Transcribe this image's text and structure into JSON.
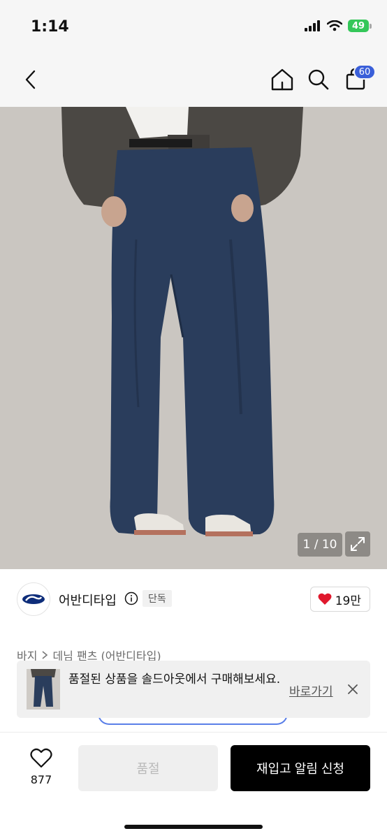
{
  "status_bar": {
    "time": "1:14",
    "battery": "49"
  },
  "header": {
    "cart_count": "60"
  },
  "gallery": {
    "counter": "1 / 10"
  },
  "brand": {
    "name": "어반디타입",
    "tag": "단독",
    "likes": "19만"
  },
  "breadcrumb": {
    "items": [
      "바지",
      "데님 팬츠 (어반디타입)"
    ]
  },
  "toast": {
    "message": "품절된 상품을 솔드아웃에서 구매해보세요.",
    "link": "바로가기"
  },
  "bottom_bar": {
    "wish_count": "877",
    "soldout_label": "품절",
    "restock_label": "재입고 알림 신청"
  },
  "colors": {
    "accent": "#3a5fd9",
    "heart": "#e0182d",
    "battery": "#34c759",
    "denim": "#2a3d5c"
  },
  "icons": [
    "back-chevron-icon",
    "home-icon",
    "search-icon",
    "shopping-bag-icon",
    "info-icon",
    "heart-icon",
    "expand-icon",
    "close-icon"
  ]
}
